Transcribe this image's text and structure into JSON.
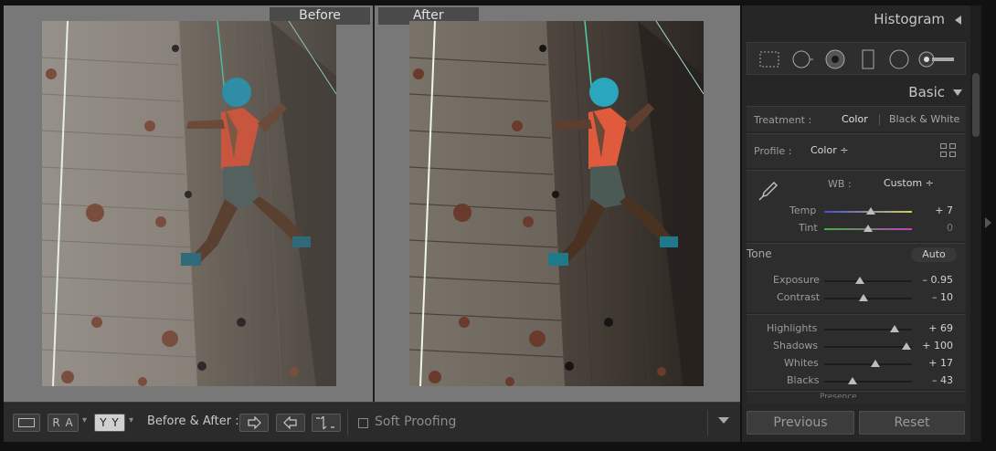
{
  "compare": {
    "before_label": "Before",
    "after_label": "After"
  },
  "toolbar": {
    "ra_label": "R A",
    "yy_label": "Y Y",
    "before_after_label": "Before & After :",
    "soft_proofing_label": "Soft Proofing"
  },
  "panel": {
    "histogram_title": "Histogram",
    "basic_title": "Basic",
    "treatment_label": "Treatment :",
    "treatment_color": "Color",
    "treatment_bw": "Black & White",
    "profile_label": "Profile :",
    "profile_value": "Color ÷",
    "wb_label": "WB :",
    "wb_value": "Custom ÷",
    "tone_label": "Tone",
    "auto_label": "Auto",
    "presence_label": "Presence",
    "sliders": {
      "temp": {
        "label": "Temp",
        "value": "+ 7",
        "level": 0.53
      },
      "tint": {
        "label": "Tint",
        "value": "0",
        "level": 0.5
      },
      "exposure": {
        "label": "Exposure",
        "value": "– 0.95",
        "level": 0.41
      },
      "contrast": {
        "label": "Contrast",
        "value": "– 10",
        "level": 0.45
      },
      "highlights": {
        "label": "Highlights",
        "value": "+ 69",
        "level": 0.8
      },
      "shadows": {
        "label": "Shadows",
        "value": "+ 100",
        "level": 0.94
      },
      "whites": {
        "label": "Whites",
        "value": "+ 17",
        "level": 0.58
      },
      "blacks": {
        "label": "Blacks",
        "value": "– 43",
        "level": 0.32
      }
    }
  },
  "buttons": {
    "previous": "Previous",
    "reset": "Reset"
  }
}
